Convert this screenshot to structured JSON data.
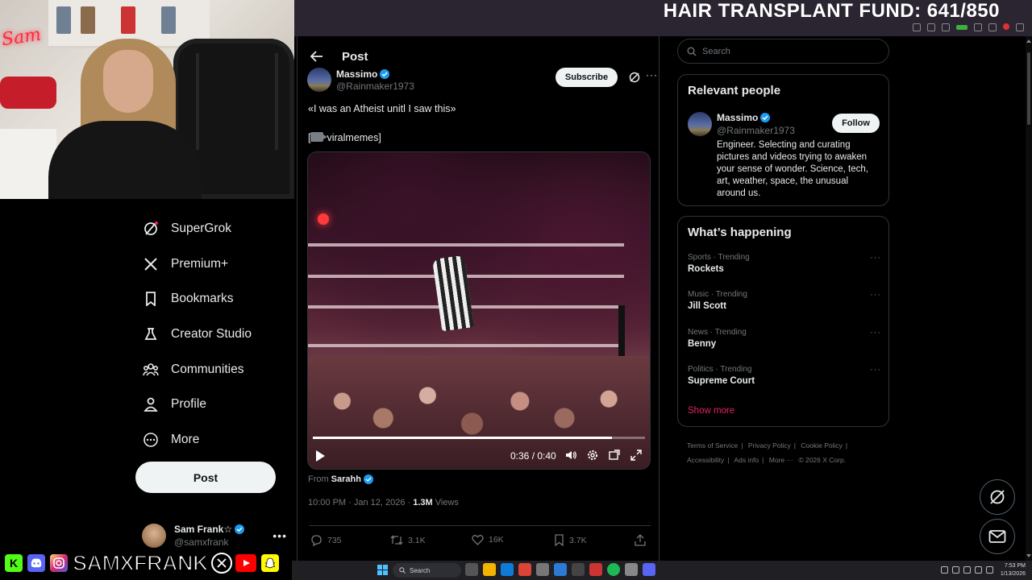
{
  "stream_overlay": {
    "banner_text": "HAIR TRANSPLANT FUND: 641/850",
    "social_handle": "SAMXFRANK",
    "social_icons": [
      "kick-icon",
      "discord-icon",
      "instagram-icon",
      "x-icon",
      "youtube-icon",
      "snapchat-icon"
    ],
    "social_colors": {
      "kick": "#53fc18",
      "discord": "#5865f2",
      "instagram": "#d62976",
      "x": "#000000",
      "youtube": "#ff0000",
      "snapchat": "#fffc00"
    }
  },
  "sidebar": {
    "items": [
      {
        "label": "SuperGrok",
        "icon": "grok-icon"
      },
      {
        "label": "Premium+",
        "icon": "x-logo-icon"
      },
      {
        "label": "Bookmarks",
        "icon": "bookmark-icon"
      },
      {
        "label": "Creator Studio",
        "icon": "flask-icon"
      },
      {
        "label": "Communities",
        "icon": "communities-icon"
      },
      {
        "label": "Profile",
        "icon": "person-icon"
      },
      {
        "label": "More",
        "icon": "more-circle-icon"
      }
    ],
    "post_button": "Post",
    "account": {
      "name": "Sam Frank☆",
      "handle": "@samxfrank",
      "more": "•••"
    }
  },
  "post": {
    "header_title": "Post",
    "author": {
      "name": "Massimo",
      "handle": "@Rainmaker1973"
    },
    "subscribe_label": "Subscribe",
    "text_line1": "«I was an Atheist unitl I saw this»",
    "text_line2_prefix": "[",
    "text_line2": "viralmemes]",
    "video": {
      "time": "0:36 / 0:40",
      "progress": 0.9
    },
    "from_label": "From",
    "from_name": "Sarahh",
    "timestamp": "10:00 PM · Jan 12, 2026 · ",
    "views_count": "1.3M",
    "views_label": " Views",
    "actions": {
      "replies": "735",
      "reposts": "3.1K",
      "likes": "16K",
      "bookmarks": "3.7K"
    }
  },
  "right": {
    "search_placeholder": "Search",
    "relevant": {
      "title": "Relevant people",
      "name": "Massimo",
      "handle": "@Rainmaker1973",
      "follow_label": "Follow",
      "bio": "Engineer. Selecting and curating pictures and videos trying to awaken your sense of wonder. Science, tech, art, weather, space, the unusual around us."
    },
    "happening": {
      "title": "What’s happening",
      "trends": [
        {
          "category": "Sports · Trending",
          "topic": "Rockets"
        },
        {
          "category": "Music · Trending",
          "topic": "Jill Scott"
        },
        {
          "category": "News · Trending",
          "topic": "Benny"
        },
        {
          "category": "Politics · Trending",
          "topic": "Supreme Court"
        }
      ],
      "show_more": "Show more"
    },
    "footer": {
      "terms": "Terms of Service",
      "privacy": "Privacy Policy",
      "cookie": "Cookie Policy",
      "accessibility": "Accessibility",
      "ads": "Ads info",
      "more": "More ···",
      "copyright": "© 2026 X Corp."
    }
  },
  "taskbar": {
    "search_label": "Search",
    "time": "7:53 PM",
    "date": "1/13/2026"
  },
  "colors": {
    "accent_verified": "#1d9bf0",
    "show_more": "#e0245e",
    "background": "#000000",
    "border": "#2f3336"
  }
}
